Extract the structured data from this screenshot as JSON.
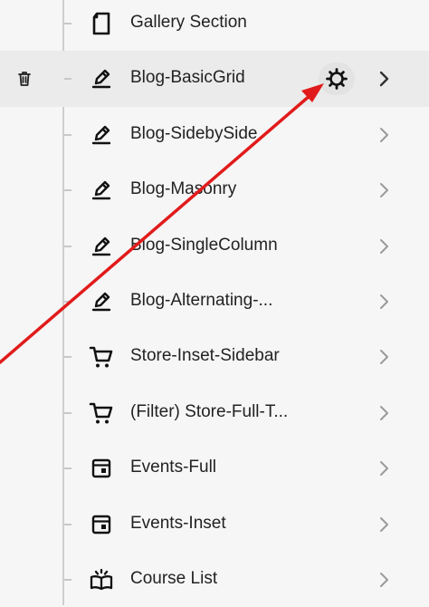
{
  "pages": [
    {
      "label": "Gallery Section",
      "icon": "page-icon",
      "selected": false
    },
    {
      "label": "Blog-BasicGrid",
      "icon": "blog-edit-icon",
      "selected": true
    },
    {
      "label": "Blog-SidebySide",
      "icon": "blog-edit-icon",
      "selected": false
    },
    {
      "label": "Blog-Masonry",
      "icon": "blog-edit-icon",
      "selected": false
    },
    {
      "label": "Blog-SingleColumn",
      "icon": "blog-edit-icon",
      "selected": false
    },
    {
      "label": "Blog-Alternating-...",
      "icon": "blog-edit-icon",
      "selected": false
    },
    {
      "label": "Store-Inset-Sidebar",
      "icon": "cart-icon",
      "selected": false
    },
    {
      "label": "(Filter) Store-Full-T...",
      "icon": "cart-icon",
      "selected": false
    },
    {
      "label": "Events-Full",
      "icon": "calendar-icon",
      "selected": false
    },
    {
      "label": "Events-Inset",
      "icon": "calendar-icon",
      "selected": false
    },
    {
      "label": "Course List",
      "icon": "course-book-icon",
      "selected": false
    }
  ],
  "selected_row_actions": {
    "delete_icon": "trash-icon",
    "settings_icon": "gear-icon"
  },
  "annotation": {
    "color": "#e11b1b",
    "kind": "arrow pointing to settings gear"
  },
  "colors": {
    "selected_row_bg": "#ebebeb",
    "gear_bg": "#e3e3e3",
    "background": "#f6f6f6"
  }
}
